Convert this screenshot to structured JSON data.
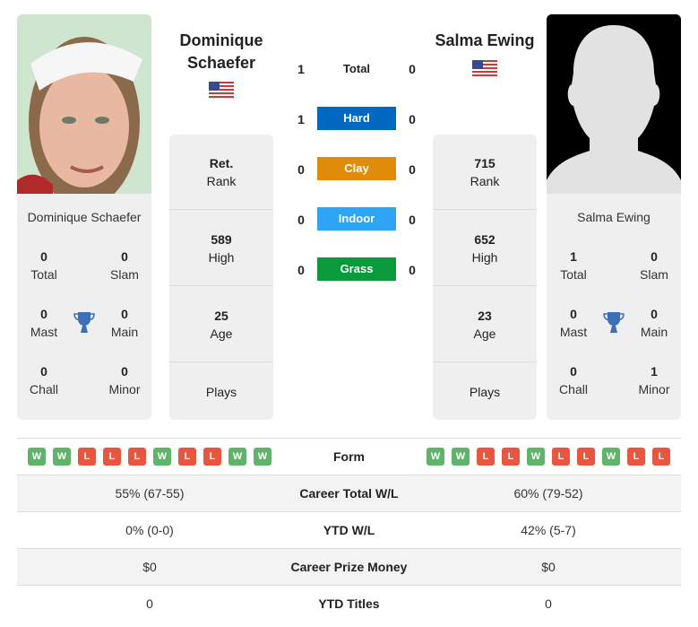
{
  "colors": {
    "hard": "#0068c0",
    "clay": "#de8c0a",
    "indoor": "#2ea4f4",
    "grass": "#0a9a3c",
    "win": "#5fb36a",
    "loss": "#e8563f",
    "trophy": "#3c6fb8"
  },
  "player1": {
    "name_line1": "Dominique",
    "name_line2": "Schaefer",
    "full_name": "Dominique Schaefer",
    "flag": "us-flag",
    "titles": {
      "total": "0",
      "slam": "0",
      "mast": "0",
      "main": "0",
      "chall": "0",
      "minor": "0"
    },
    "rank": "Ret.",
    "high": "589",
    "age": "25",
    "plays": "",
    "form": [
      "W",
      "W",
      "L",
      "L",
      "L",
      "W",
      "L",
      "L",
      "W",
      "W"
    ],
    "career_wl": "55% (67-55)",
    "ytd_wl": "0% (0-0)",
    "prize": "$0",
    "ytd_titles": "0"
  },
  "player2": {
    "name": "Salma Ewing",
    "full_name": "Salma Ewing",
    "flag": "us-flag",
    "titles": {
      "total": "1",
      "slam": "0",
      "mast": "0",
      "main": "0",
      "chall": "0",
      "minor": "1"
    },
    "rank": "715",
    "high": "652",
    "age": "23",
    "plays": "",
    "form": [
      "W",
      "W",
      "L",
      "L",
      "W",
      "L",
      "L",
      "W",
      "L",
      "L"
    ],
    "career_wl": "60% (79-52)",
    "ytd_wl": "42% (5-7)",
    "prize": "$0",
    "ytd_titles": "0"
  },
  "labels": {
    "total": "Total",
    "slam": "Slam",
    "mast": "Mast",
    "main": "Main",
    "chall": "Chall",
    "minor": "Minor",
    "rank": "Rank",
    "high": "High",
    "age": "Age",
    "plays": "Plays",
    "form": "Form",
    "career_wl": "Career Total W/L",
    "ytd_wl": "YTD W/L",
    "prize": "Career Prize Money",
    "ytd_titles": "YTD Titles"
  },
  "h2h": [
    {
      "label": "Total",
      "p1": "1",
      "p2": "0",
      "surface": null
    },
    {
      "label": "Hard",
      "p1": "1",
      "p2": "0",
      "surface": "hard"
    },
    {
      "label": "Clay",
      "p1": "0",
      "p2": "0",
      "surface": "clay"
    },
    {
      "label": "Indoor",
      "p1": "0",
      "p2": "0",
      "surface": "indoor"
    },
    {
      "label": "Grass",
      "p1": "0",
      "p2": "0",
      "surface": "grass"
    }
  ]
}
